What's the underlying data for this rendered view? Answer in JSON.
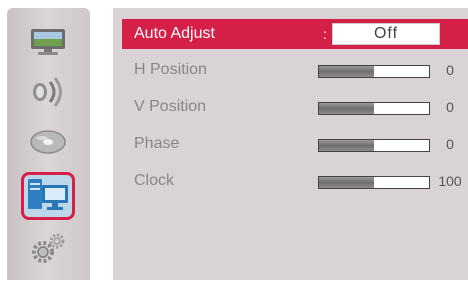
{
  "sidebar": {
    "items": [
      {
        "icon": "monitor-icon",
        "active": false
      },
      {
        "icon": "audio-icon",
        "active": false
      },
      {
        "icon": "disc-icon",
        "active": false
      },
      {
        "icon": "computer-icon",
        "active": true
      },
      {
        "icon": "gears-icon",
        "active": false
      }
    ]
  },
  "menu": {
    "auto_adjust": {
      "label": "Auto Adjust",
      "separator": ":",
      "value": "Off"
    },
    "h_position": {
      "label": "H Position",
      "value": "0",
      "level": 0.5
    },
    "v_position": {
      "label": "V Position",
      "value": "0",
      "level": 0.5
    },
    "phase": {
      "label": "Phase",
      "value": "0",
      "level": 0.5
    },
    "clock": {
      "label": "Clock",
      "value": "100",
      "level": 0.5
    }
  },
  "colors": {
    "highlight": "#d41f46",
    "panel_bg": "#d9d3d5",
    "label_text": "#8a8587"
  }
}
